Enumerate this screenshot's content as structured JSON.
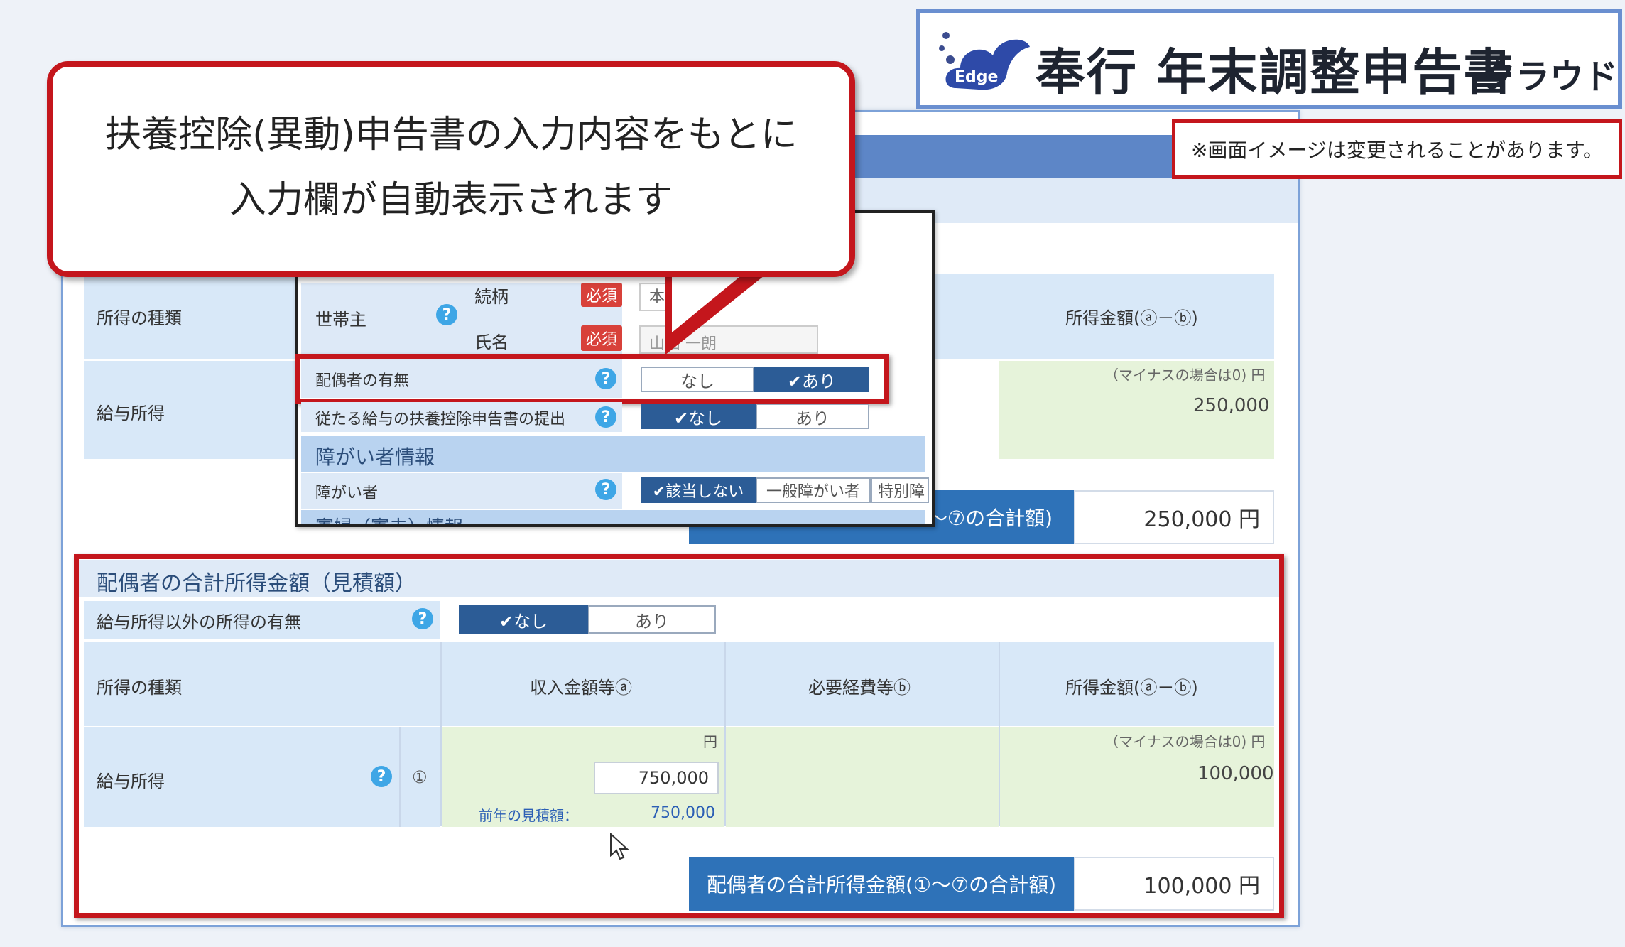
{
  "logo": {
    "badge": "Edge",
    "title": "奉行 年末調整申告書",
    "suffix": "クラウド"
  },
  "notice": "※画面イメージは変更されることがあります。",
  "callout": {
    "line1": "扶養控除(異動)申告書の入力内容をもとに",
    "line2": "入力欄が自動表示されます"
  },
  "base_form": {
    "income_type_label": "所得の種類",
    "income_amount_label": "所得金額(ⓐ－ⓑ)",
    "salary_income_label": "給与所得",
    "minus_note": "（マイナスの場合は0) 円",
    "salary_income_value": "250,000",
    "total_label": "～⑦の合計額)",
    "total_value": "250,000 円"
  },
  "popup": {
    "householder_label": "世帯主",
    "relation_label": "続柄",
    "relation_value": "本",
    "name_label": "氏名",
    "name_value": "山田 一朗",
    "required": "必須",
    "spouse_label": "配偶者の有無",
    "spouse_options": [
      "なし",
      "✔あり"
    ],
    "main_salary_label": "従たる給与の扶養控除申告書の提出",
    "main_salary_options": [
      "✔なし",
      "あり"
    ],
    "disability_section": "障がい者情報",
    "disability_label": "障がい者",
    "disability_options": [
      "✔該当しない",
      "一般障がい者",
      "特別障"
    ],
    "next_section": "寡婦（寡夫）情報"
  },
  "spouse_section": {
    "title": "配偶者の合計所得金額（見積額）",
    "other_income_label": "給与所得以外の所得の有無",
    "other_income_options": [
      "✔なし",
      "あり"
    ],
    "income_type_label": "所得の種類",
    "revenue_label": "収入金額等ⓐ",
    "expense_label": "必要経費等ⓑ",
    "income_amount_label": "所得金額(ⓐ－ⓑ)",
    "salary_income_label": "給与所得",
    "row_number": "①",
    "yen": "円",
    "revenue_input": "750,000",
    "prev_label": "前年の見積額：",
    "prev_value": "750,000",
    "minus_note": "（マイナスの場合は0) 円",
    "income_value": "100,000",
    "total_label": "配偶者の合計所得金額(①～⑦の合計額)",
    "total_value": "100,000 円"
  }
}
